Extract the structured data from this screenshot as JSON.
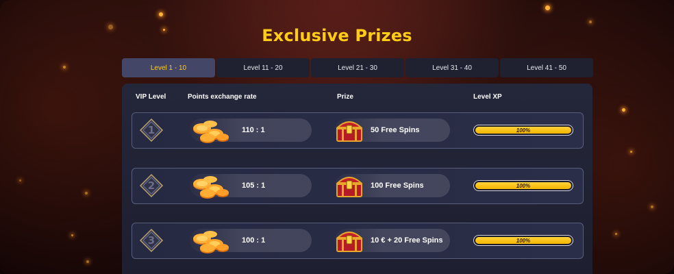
{
  "title": "Exclusive Prizes",
  "tabs": [
    {
      "label": "Level 1 - 10",
      "active": true
    },
    {
      "label": "Level 11 - 20",
      "active": false
    },
    {
      "label": "Level 21 - 30",
      "active": false
    },
    {
      "label": "Level 31 - 40",
      "active": false
    },
    {
      "label": "Level 41 - 50",
      "active": false
    }
  ],
  "columns": {
    "vip_level": "VIP Level",
    "points_rate": "Points exchange rate",
    "prize": "Prize",
    "level_xp": "Level XP"
  },
  "rows": [
    {
      "level": "1",
      "rate": "110 : 1",
      "prize": "50 Free Spins",
      "xp_label": "100%",
      "xp_fraction": 1.0
    },
    {
      "level": "2",
      "rate": "105 : 1",
      "prize": "100 Free Spins",
      "xp_label": "100%",
      "xp_fraction": 1.0
    },
    {
      "level": "3",
      "rate": "100 : 1",
      "prize": "10 € + 20 Free Spins",
      "xp_label": "100%",
      "xp_fraction": 1.0
    }
  ],
  "icons": {
    "coins": "coins-icon",
    "chest": "treasure-chest-icon",
    "badge": "diamond-badge-icon"
  },
  "colors": {
    "title": "#ffcc16",
    "active_tab_text": "#ffcc16",
    "xp_fill": "#f3b400"
  }
}
